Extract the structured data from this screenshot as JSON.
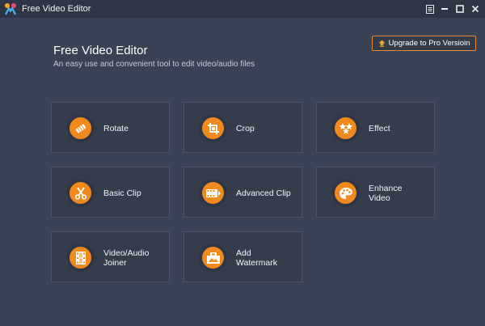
{
  "window": {
    "title": "Free Video Editor",
    "controls": [
      "menu-icon",
      "minimize-icon",
      "maximize-icon",
      "close-icon"
    ]
  },
  "header": {
    "title": "Free Video Editor",
    "subtitle": "An easy use and convenient tool to edit video/audio files"
  },
  "upgrade": {
    "label": "Upgrade to Pro Versioin",
    "icon": "upgrade-icon"
  },
  "colors": {
    "background": "#3a4355",
    "titlebar": "#2e3544",
    "tile": "#353d4d",
    "accent": "#f08a1c",
    "upgrade_border": "#e8893a"
  },
  "tools": [
    {
      "label": "Rotate",
      "icon": "rotate-icon"
    },
    {
      "label": "Crop",
      "icon": "crop-icon"
    },
    {
      "label": "Effect",
      "icon": "effect-icon"
    },
    {
      "label": "Basic Clip",
      "icon": "scissors-icon"
    },
    {
      "label": "Advanced Clip",
      "icon": "film-clip-icon"
    },
    {
      "label": "Enhance\nVideo",
      "icon": "palette-icon"
    },
    {
      "label": "Video/Audio\nJoiner",
      "icon": "joiner-icon"
    },
    {
      "label": "Add\nWatermark",
      "icon": "watermark-icon"
    }
  ]
}
